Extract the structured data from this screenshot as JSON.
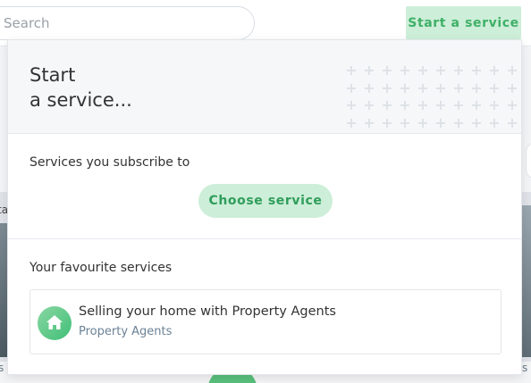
{
  "header": {
    "search": {
      "placeholder": "Search",
      "value": ""
    },
    "start_service_label": "Start a service"
  },
  "background": {
    "left_fragment": "ta",
    "left_bottom_fragment": "s",
    "right_bottom_fragment": "s"
  },
  "dropdown": {
    "title_line1": "Start",
    "title_line2": "a service...",
    "subscribe": {
      "label": "Services you subscribe to",
      "choose_label": "Choose service"
    },
    "favourites": {
      "label": "Your favourite services",
      "items": [
        {
          "title": "Selling your home with Property Agents",
          "provider": "Property Agents",
          "icon": "house-icon"
        }
      ]
    }
  },
  "colors": {
    "accent_green": "#3fb068",
    "button_bg": "#cdeed8",
    "provider_text": "#6b8296"
  }
}
